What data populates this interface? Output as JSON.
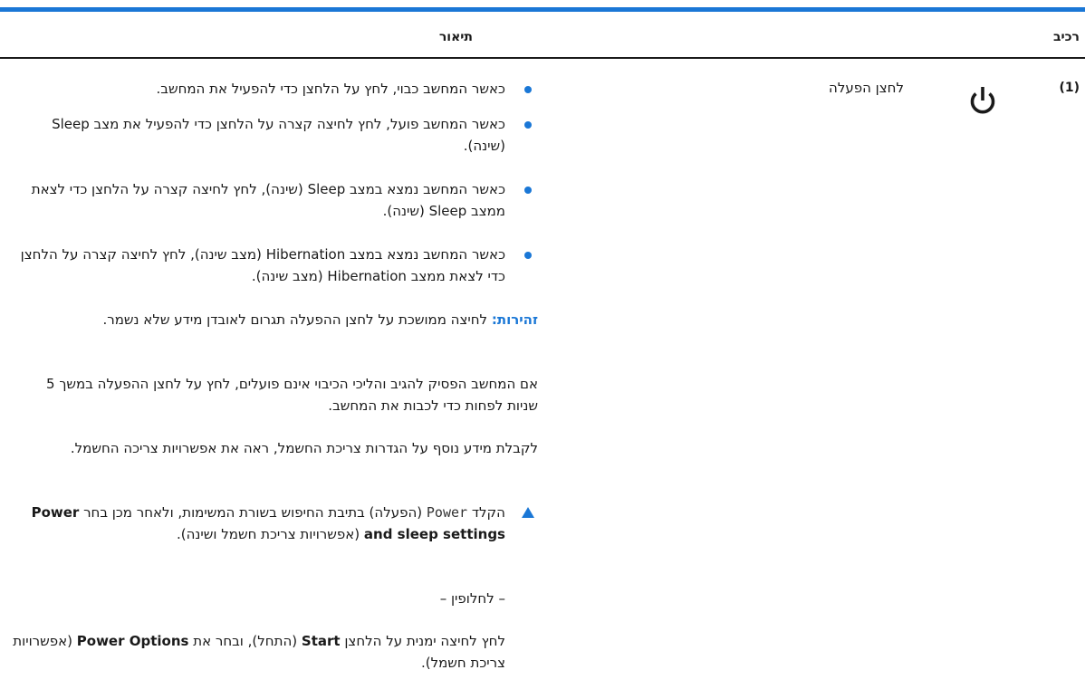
{
  "table": {
    "header_component": "רכיב",
    "header_description": "תיאור"
  },
  "row": {
    "number": "(1)",
    "component_name": "לחצן הפעלה",
    "icon": "power-icon"
  },
  "bullets": [
    "כאשר המחשב כבוי, לחץ על הלחצן כדי להפעיל את המחשב.",
    "כאשר המחשב פועל, לחץ לחיצה קצרה על הלחצן כדי להפעיל את מצב Sleep (שינה).",
    "כאשר המחשב נמצא במצב Sleep (שינה), לחץ לחיצה קצרה על הלחצן כדי לצאת ממצב Sleep (שינה).",
    "כאשר המחשב נמצא במצב Hibernation (מצב שינה), לחץ לחיצה קצרה על הלחצן כדי לצאת ממצב Hibernation (מצב שינה)."
  ],
  "warning": {
    "label": "זהירות:",
    "text": "לחיצה ממושכת על לחצן ההפעלה תגרום לאובדן מידע שלא נשמר."
  },
  "paragraph_shutdown": "אם המחשב הפסיק להגיב והליכי הכיבוי אינם פועלים, לחץ על לחצן ההפעלה במשך 5 שניות לפחות כדי לכבות את המחשב.",
  "paragraph_info": "לקבלת מידע נוסף על הגדרות צריכת החשמל, ראה את אפשרויות צריכה החשמל.",
  "step": {
    "before_code": "הקלד ",
    "code": "Power",
    "after_code": " (הפעלה) בתיבת החיפוש בשורת המשימות, ולאחר מכן בחר ",
    "bold": "Power and sleep settings",
    "after_bold": " (אפשרויות צריכת חשמל ושינה)."
  },
  "alternative": "– לחלופין –",
  "alt_step": {
    "before_start": "לחץ לחיצה ימנית על הלחצן ",
    "start": "Start",
    "middle": " (התחל), ובחר את ",
    "power_options": "Power Options",
    "end": " (אפשרויות צריכת חשמל)."
  },
  "colors": {
    "accent": "#1a77d6",
    "text": "#1a1a1a"
  }
}
